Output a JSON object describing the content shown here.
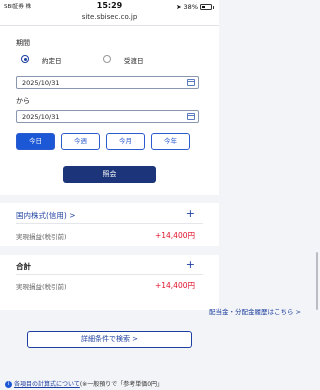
{
  "status_bar": {
    "carrier": "SBI証券 株",
    "time": "15:29",
    "battery": "38%"
  },
  "browser": {
    "url": "site.sbisec.co.jp"
  },
  "filter": {
    "period_label": "期間",
    "radio_options": [
      "約定日",
      "受渡日"
    ],
    "selected_option": "約定日",
    "start_date": "2025/10/31",
    "from_label": "から",
    "end_date": "2025/10/31",
    "range_buttons": [
      "今日",
      "今週",
      "今月",
      "今年"
    ],
    "active_range": "今日",
    "submit_label": "照会"
  },
  "results": {
    "domestic": {
      "title": "国内株式(信用) >",
      "row_label": "実現損益(税引前)",
      "row_value": "+14,400円"
    },
    "total": {
      "title": "合計",
      "row_label": "実現損益(税引前)",
      "row_value": "+14,400円"
    },
    "dividend_link": "配当金・分配金履歴はこちら >",
    "detail_button": "詳細条件で検索 >"
  },
  "footnote": {
    "link_text": "各項目の計算式について",
    "rest_text": "(※一般預りで「参考単価0円」"
  },
  "colors": {
    "primary_dark": "#1b347a",
    "primary_blue": "#1c57d6",
    "profit_red": "#e0102a"
  }
}
